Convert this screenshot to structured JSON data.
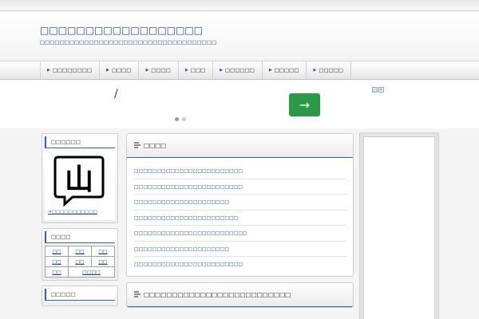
{
  "header": {
    "title": "□□□□□□□□□□□□□□□□□□",
    "description": "□□□□□□□□□□□□□□□□□□□□□□□□□□□□□□□□□□□□"
  },
  "nav": {
    "items": [
      {
        "label": "□□□□□□□□"
      },
      {
        "label": "□□□□"
      },
      {
        "label": "□□□□"
      },
      {
        "label": "□□□"
      },
      {
        "label": "□□□□□□"
      },
      {
        "label": "□□□□□"
      },
      {
        "label": "□□□□□"
      }
    ]
  },
  "ad": {
    "slash": "/",
    "button_arrow": "→",
    "choices": [
      "ⓘ",
      "✕"
    ]
  },
  "sidebar": {
    "profile_title": "□□□□□□",
    "profile_icon_text": "山",
    "profile_link": "⇒□□□□□□□□□□□",
    "calendar_title": "□□□□",
    "calendar_rows": [
      [
        "□□",
        "□□",
        "□□"
      ],
      [
        "□□",
        "□□",
        "□□"
      ],
      [
        "□□",
        "□□□□"
      ]
    ],
    "third_title": "□□□□□"
  },
  "main": {
    "box1_title": "□□□□",
    "box1_items": [
      "□□□□□□□□□□□□□□□□□□□□□□□□",
      "□□□□□□□□□□□□□□□□□□□□□□□□",
      "□□□□□□□□□□□□□□□□□□□□□",
      "□□□□□□□□□□□□□□□□□□□□□□□",
      "□□□□□□□□□□□□□□□□□□□□□□□□□",
      "□□□□□□□□□□□□□□□□□□□□□",
      "□□□□□□□□□□□□□□□□□□□□□□□□"
    ],
    "box2_title": "□□□□□□□□□□□□□□□□□□□□□□□□□□"
  },
  "colors": {
    "link": "#1f4fa0",
    "title": "#1f3f8f",
    "ad_button": "#2a9a48"
  }
}
